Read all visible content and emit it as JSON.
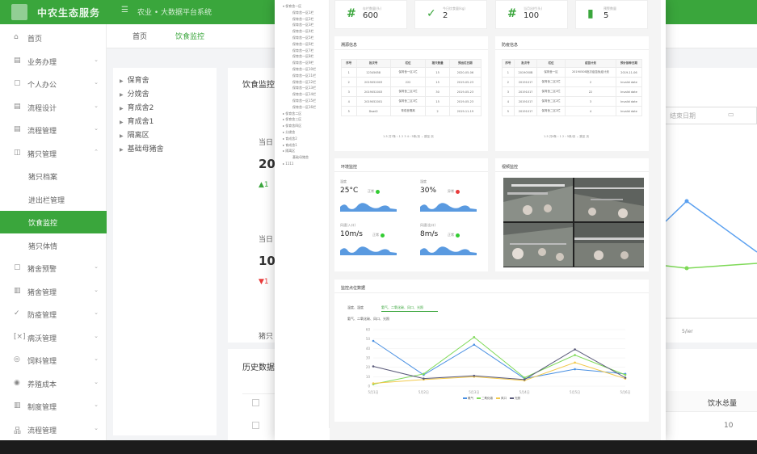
{
  "header": {
    "app_name": "中农生态服务",
    "menu_text": "☰",
    "menu_sub": "农业 • 大数据平台系统"
  },
  "sidebar": {
    "items": [
      {
        "label": "首页",
        "icon": "⌂",
        "chev": ""
      },
      {
        "label": "业务办理",
        "icon": "▤",
        "chev": "⌄"
      },
      {
        "label": "个人办公",
        "icon": "▢",
        "chev": "⌄"
      },
      {
        "label": "流程设计",
        "icon": "▤",
        "chev": "⌄"
      },
      {
        "label": "流程管理",
        "icon": "▤",
        "chev": "⌄"
      },
      {
        "label": "猪只管理",
        "icon": "◫",
        "chev": "⌃"
      },
      {
        "label": "猪只档案",
        "icon": "",
        "chev": ""
      },
      {
        "label": "进出栏管理",
        "icon": "",
        "chev": ""
      },
      {
        "label": "饮食监控",
        "icon": "",
        "chev": ""
      },
      {
        "label": "猪只体情",
        "icon": "",
        "chev": ""
      },
      {
        "label": "猪舍预警",
        "icon": "▢",
        "chev": "⌄"
      },
      {
        "label": "猪舍管理",
        "icon": "▥",
        "chev": "⌄"
      },
      {
        "label": "防疫管理",
        "icon": "✓",
        "chev": "⌄"
      },
      {
        "label": "病沃管理",
        "icon": "[×]",
        "chev": "⌄"
      },
      {
        "label": "饲料管理",
        "icon": "◎",
        "chev": "⌄"
      },
      {
        "label": "养殖成本",
        "icon": "◉",
        "chev": "⌄"
      },
      {
        "label": "制度管理",
        "icon": "▥",
        "chev": "⌄"
      },
      {
        "label": "流程管理",
        "icon": "品",
        "chev": "⌄"
      }
    ]
  },
  "tabs": [
    {
      "label": "首页"
    },
    {
      "label": "饮食监控"
    }
  ],
  "tree": [
    {
      "label": "保育舍"
    },
    {
      "label": "分娩舍"
    },
    {
      "label": "育成舍2"
    },
    {
      "label": "育成舍1"
    },
    {
      "label": "隔离区"
    },
    {
      "label": "基础母猪舍"
    }
  ],
  "background": {
    "panel_title": "饮食监控",
    "today_label_1": "当日",
    "today_value_1": "20",
    "today_trend_1": "▲1",
    "today_label_2": "当日",
    "today_value_2": "10",
    "today_trend_2": "▼1",
    "footer_text": "猪只",
    "history_title": "历史数据",
    "date_placeholder": "结束日期",
    "calendar_icon": "calendar-icon",
    "x_tick": "5/ier",
    "table_col": "饮水总量",
    "table_cell": "10"
  },
  "modal": {
    "tree_items": [
      "▾ 保育舍一区",
      "保育舍一区1栏",
      "保育舍一区2栏",
      "保育舍一区3栏",
      "保育舍一区4栏",
      "保育舍一区5栏",
      "保育舍一区6栏",
      "保育舍一区7栏",
      "保育舍一区8栏",
      "保育舍一区9栏",
      "保育舍一区10栏",
      "保育舍一区11栏",
      "保育舍一区12栏",
      "保育舍一区13栏",
      "保育舍一区14栏",
      "保育舍一区15栏",
      "保育舍一区16栏",
      "▸ 保育舍二区",
      "▸ 保育舍三区",
      "▸ 保育舍四区",
      "▸ 分娩舍",
      "▸ 育成舍2",
      "▸ 育成舍1",
      "▸ 隔离区",
      "基础母猪舍",
      "▸ 1111"
    ],
    "stats": [
      {
        "label": "存栏数量(头)",
        "value": "600",
        "icon": "#"
      },
      {
        "label": "今日饮食量(kg)",
        "value": "2",
        "icon": "✓"
      },
      {
        "label": "当月出栏(头)",
        "value": "100",
        "icon": "#"
      },
      {
        "label": "预警数量",
        "value": "5",
        "icon": "▮"
      }
    ],
    "trace": {
      "title": "溯源信息",
      "headers": [
        "序号",
        "批次号",
        "栏位",
        "猪只数量",
        "预出栏日期"
      ],
      "rows": [
        [
          "1",
          "12345658",
          "保育舍一区1栏",
          "15",
          "2020-05-06"
        ],
        [
          "2",
          "2019052003",
          "222",
          "15",
          "2019-05-23"
        ],
        [
          "3",
          "2019052003",
          "保育舍二区3栏",
          "30",
          "2019-05-23"
        ],
        [
          "4",
          "2019052001",
          "保育舍二区3栏",
          "15",
          "2019-05-23"
        ],
        [
          "5",
          "Dsad2",
          "育成舍隔离",
          "2",
          "2019-11-19"
        ]
      ],
      "pager": "1-5 共7条 ‹ 1 2 3 4 › 5条/页 ⌄ 跳至 页"
    },
    "vaccine": {
      "title": "防疫信息",
      "headers": [
        "序号",
        "批次号",
        "栏位",
        "疫苗计划",
        "预计接种日期"
      ],
      "rows": [
        [
          "1",
          "2019050B",
          "保育舍一区",
          "2019050B批次疫苗免疫计划",
          "2019-11-06"
        ],
        [
          "2",
          "2019101?",
          "保育舍二区2栏",
          "2",
          "Invalid date"
        ],
        [
          "3",
          "2019101?",
          "保育舍二区2栏",
          "22",
          "Invalid date"
        ],
        [
          "4",
          "2019101?",
          "保育舍二区2栏",
          "3",
          "Invalid date"
        ],
        [
          "5",
          "2019101?",
          "保育舍二区2栏",
          "4",
          "Invalid date"
        ]
      ],
      "pager": "1-5 共6条 ‹ 1 2 › 5条/页 ⌄ 跳至 页"
    },
    "env": {
      "title": "环境监控",
      "items": [
        {
          "label": "温度",
          "value": "25°C",
          "status": "正常",
          "color": "#33cc33"
        },
        {
          "label": "湿度",
          "value": "30%",
          "status": "异常",
          "color": "#e83b3b"
        },
        {
          "label": "风速(入口)",
          "value": "10m/s",
          "status": "正常",
          "color": "#33cc33"
        },
        {
          "label": "风速(出口)",
          "value": "8m/s",
          "status": "正常",
          "color": "#33cc33"
        }
      ]
    },
    "video": {
      "title": "视频监控"
    },
    "chart_panel": {
      "title": "监控点位数据",
      "tabs": [
        "温度、湿度",
        "氨气、二氧化碳、风口、光照"
      ],
      "subtitle": "氨气、二氧化碳、风口、光照"
    }
  },
  "chart_data": {
    "type": "line",
    "title": "",
    "x": [
      "5月1日",
      "5月2日",
      "5月3日",
      "5月4日",
      "5月5日",
      "5月6日"
    ],
    "ylim": [
      0,
      60
    ],
    "yticks": [
      0,
      10,
      20,
      30,
      40,
      50,
      60
    ],
    "series": [
      {
        "name": "氨气",
        "color": "#4a90e2",
        "values": [
          48,
          12,
          44,
          8,
          18,
          13
        ]
      },
      {
        "name": "二氧化碳",
        "color": "#7ed957",
        "values": [
          2,
          13,
          52,
          9,
          33,
          12
        ]
      },
      {
        "name": "风口",
        "color": "#f2c94c",
        "values": [
          3,
          7,
          10,
          6,
          25,
          8
        ]
      },
      {
        "name": "光照",
        "color": "#5a5a7a",
        "values": [
          21,
          8,
          11,
          7,
          39,
          9
        ]
      }
    ]
  }
}
